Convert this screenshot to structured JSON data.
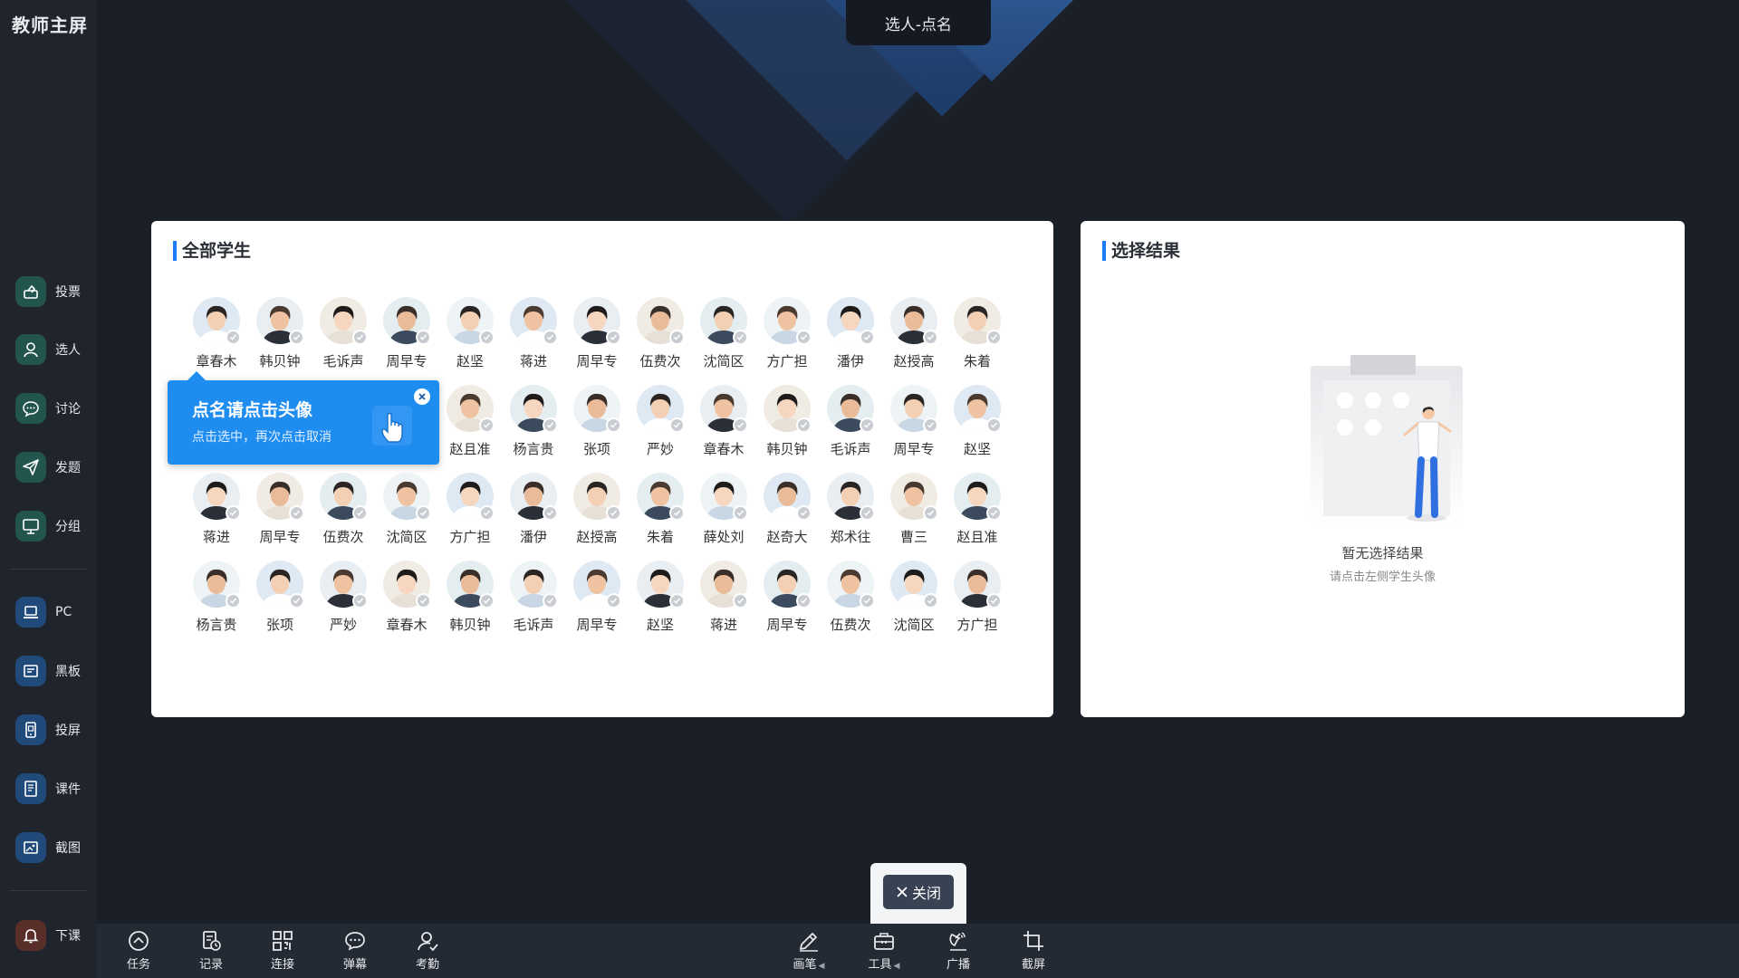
{
  "app": {
    "title": "教师主屏"
  },
  "top_tab": {
    "label": "选人-点名"
  },
  "sidebar": {
    "items": [
      {
        "label": "投票",
        "icon": "vote-icon"
      },
      {
        "label": "选人",
        "icon": "person-icon"
      },
      {
        "label": "讨论",
        "icon": "chat-icon"
      },
      {
        "label": "发题",
        "icon": "send-icon"
      },
      {
        "label": "分组",
        "icon": "monitor-icon"
      },
      {
        "label": "PC",
        "icon": "laptop-icon"
      },
      {
        "label": "黑板",
        "icon": "blackboard-icon"
      },
      {
        "label": "投屏",
        "icon": "cast-icon"
      },
      {
        "label": "课件",
        "icon": "courseware-icon"
      },
      {
        "label": "截图",
        "icon": "screenshot-icon"
      }
    ],
    "end_class": {
      "label": "下课",
      "icon": "bell-icon"
    }
  },
  "students_panel": {
    "title": "全部学生",
    "students": [
      "章春木",
      "韩贝钟",
      "毛诉声",
      "周早专",
      "赵坚",
      "蒋进",
      "周早专",
      "伍费次",
      "沈简区",
      "方广担",
      "潘伊",
      "赵授高",
      "朱着",
      "杨言贵",
      "张项",
      "严妙",
      "周早专",
      "赵且准",
      "杨言贵",
      "张项",
      "严妙",
      "章春木",
      "韩贝钟",
      "毛诉声",
      "周早专",
      "赵坚",
      "蒋进",
      "周早专",
      "伍费次",
      "沈简区",
      "方广担",
      "潘伊",
      "赵授高",
      "朱着",
      "薛处刘",
      "赵奇大",
      "郑术往",
      "曹三",
      "赵且准",
      "杨言贵",
      "张项",
      "严妙",
      "章春木",
      "韩贝钟",
      "毛诉声",
      "周早专",
      "赵坚",
      "蒋进",
      "周早专",
      "伍费次",
      "沈简区",
      "方广担"
    ]
  },
  "tooltip": {
    "title": "点名请点击头像",
    "subtitle": "点击选中，再次点击取消"
  },
  "result_panel": {
    "title": "选择结果",
    "empty_title": "暂无选择结果",
    "empty_subtitle": "请点击左侧学生头像"
  },
  "close_button": {
    "label": "关闭"
  },
  "bottombar": {
    "left": [
      {
        "label": "任务",
        "icon": "task-icon"
      },
      {
        "label": "记录",
        "icon": "record-icon"
      },
      {
        "label": "连接",
        "icon": "qrcode-icon"
      },
      {
        "label": "弹幕",
        "icon": "danmaku-icon"
      },
      {
        "label": "考勤",
        "icon": "attendance-icon"
      }
    ],
    "right": [
      {
        "label": "画笔",
        "icon": "pen-icon",
        "caret": true
      },
      {
        "label": "工具",
        "icon": "toolbox-icon",
        "caret": true
      },
      {
        "label": "广播",
        "icon": "broadcast-icon",
        "caret": false
      },
      {
        "label": "截屏",
        "icon": "crop-icon",
        "caret": false
      }
    ]
  },
  "colors": {
    "accent": "#1c7cf5",
    "tooltip": "#1f8cf0",
    "sidebar": "#1f242d",
    "background": "#1b1f27"
  }
}
